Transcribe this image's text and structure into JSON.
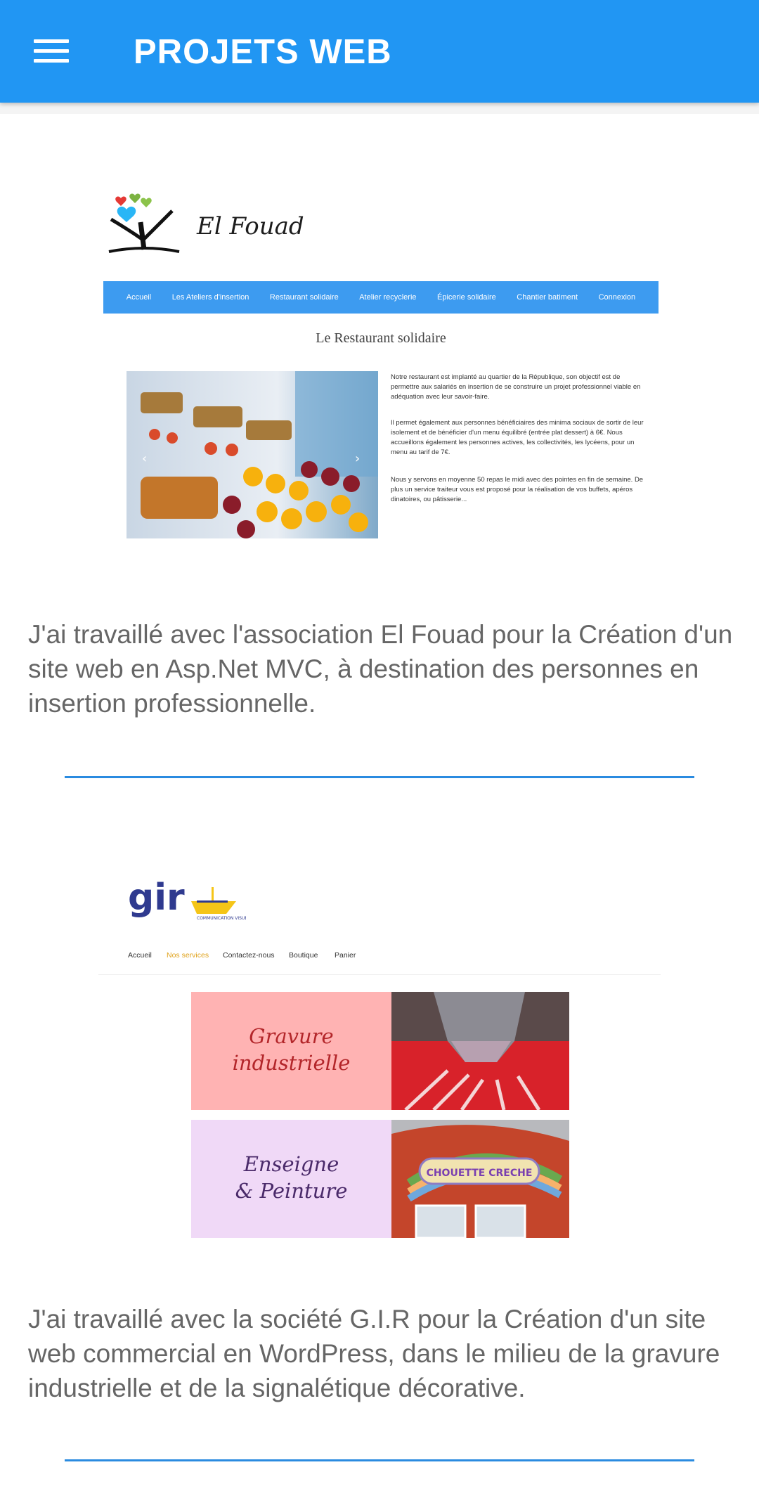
{
  "app_bar": {
    "title": "PROJETS WEB",
    "menu_icon": "hamburger-menu-icon",
    "color": "#2196f3"
  },
  "projects": [
    {
      "screenshot": {
        "brand": "El Fouad",
        "nav": [
          "Accueil",
          "Les Ateliers d'insertion",
          "Restaurant solidaire",
          "Atelier recyclerie",
          "Épicerie solidaire",
          "Chantier batiment",
          "Connexion"
        ],
        "page_title": "Le Restaurant solidaire",
        "paragraphs": [
          "Notre restaurant est implanté au quartier de la République, son objectif est de permettre aux salariés en insertion de se construire un projet professionnel viable en adéquation avec leur savoir-faire.",
          "Il permet également aux personnes bénéficiaires des minima sociaux de sortir de leur isolement et de bénéficier d'un menu équilibré (entrée plat dessert) à 6€. Nous accueillons également les personnes actives, les collectivités, les lycéens, pour un menu au tarif de 7€.",
          "Nous y servons en moyenne 50 repas le midi avec des pointes en fin de semaine. De plus un service traiteur vous est proposé pour la réalisation de vos buffets, apéros dinatoires, ou pâtisserie..."
        ]
      },
      "description": "J'ai travaillé avec l'association El Fouad pour la Création d'un site web en Asp.Net MVC, à destination des personnes en insertion professionnelle."
    },
    {
      "screenshot": {
        "brand": "gir",
        "tagline": "COMMUNICATION VISUELLE",
        "nav": [
          "Accueil",
          "Nos services",
          "Contactez-nous",
          "Boutique",
          "Panier"
        ],
        "panels": [
          {
            "text": "Gravure industrielle",
            "line1": "Gravure",
            "line2": "industrielle"
          },
          {
            "text": "Enseigne & Peinture",
            "line1": "Enseigne",
            "line2": "& Peinture"
          }
        ],
        "sign_text": "CHOUETTE CRECHE"
      },
      "description": "J'ai travaillé avec la société G.I.R pour la Création d'un site web commercial en WordPress, dans le milieu de la gravure industrielle et de la signalétique décorative."
    }
  ]
}
